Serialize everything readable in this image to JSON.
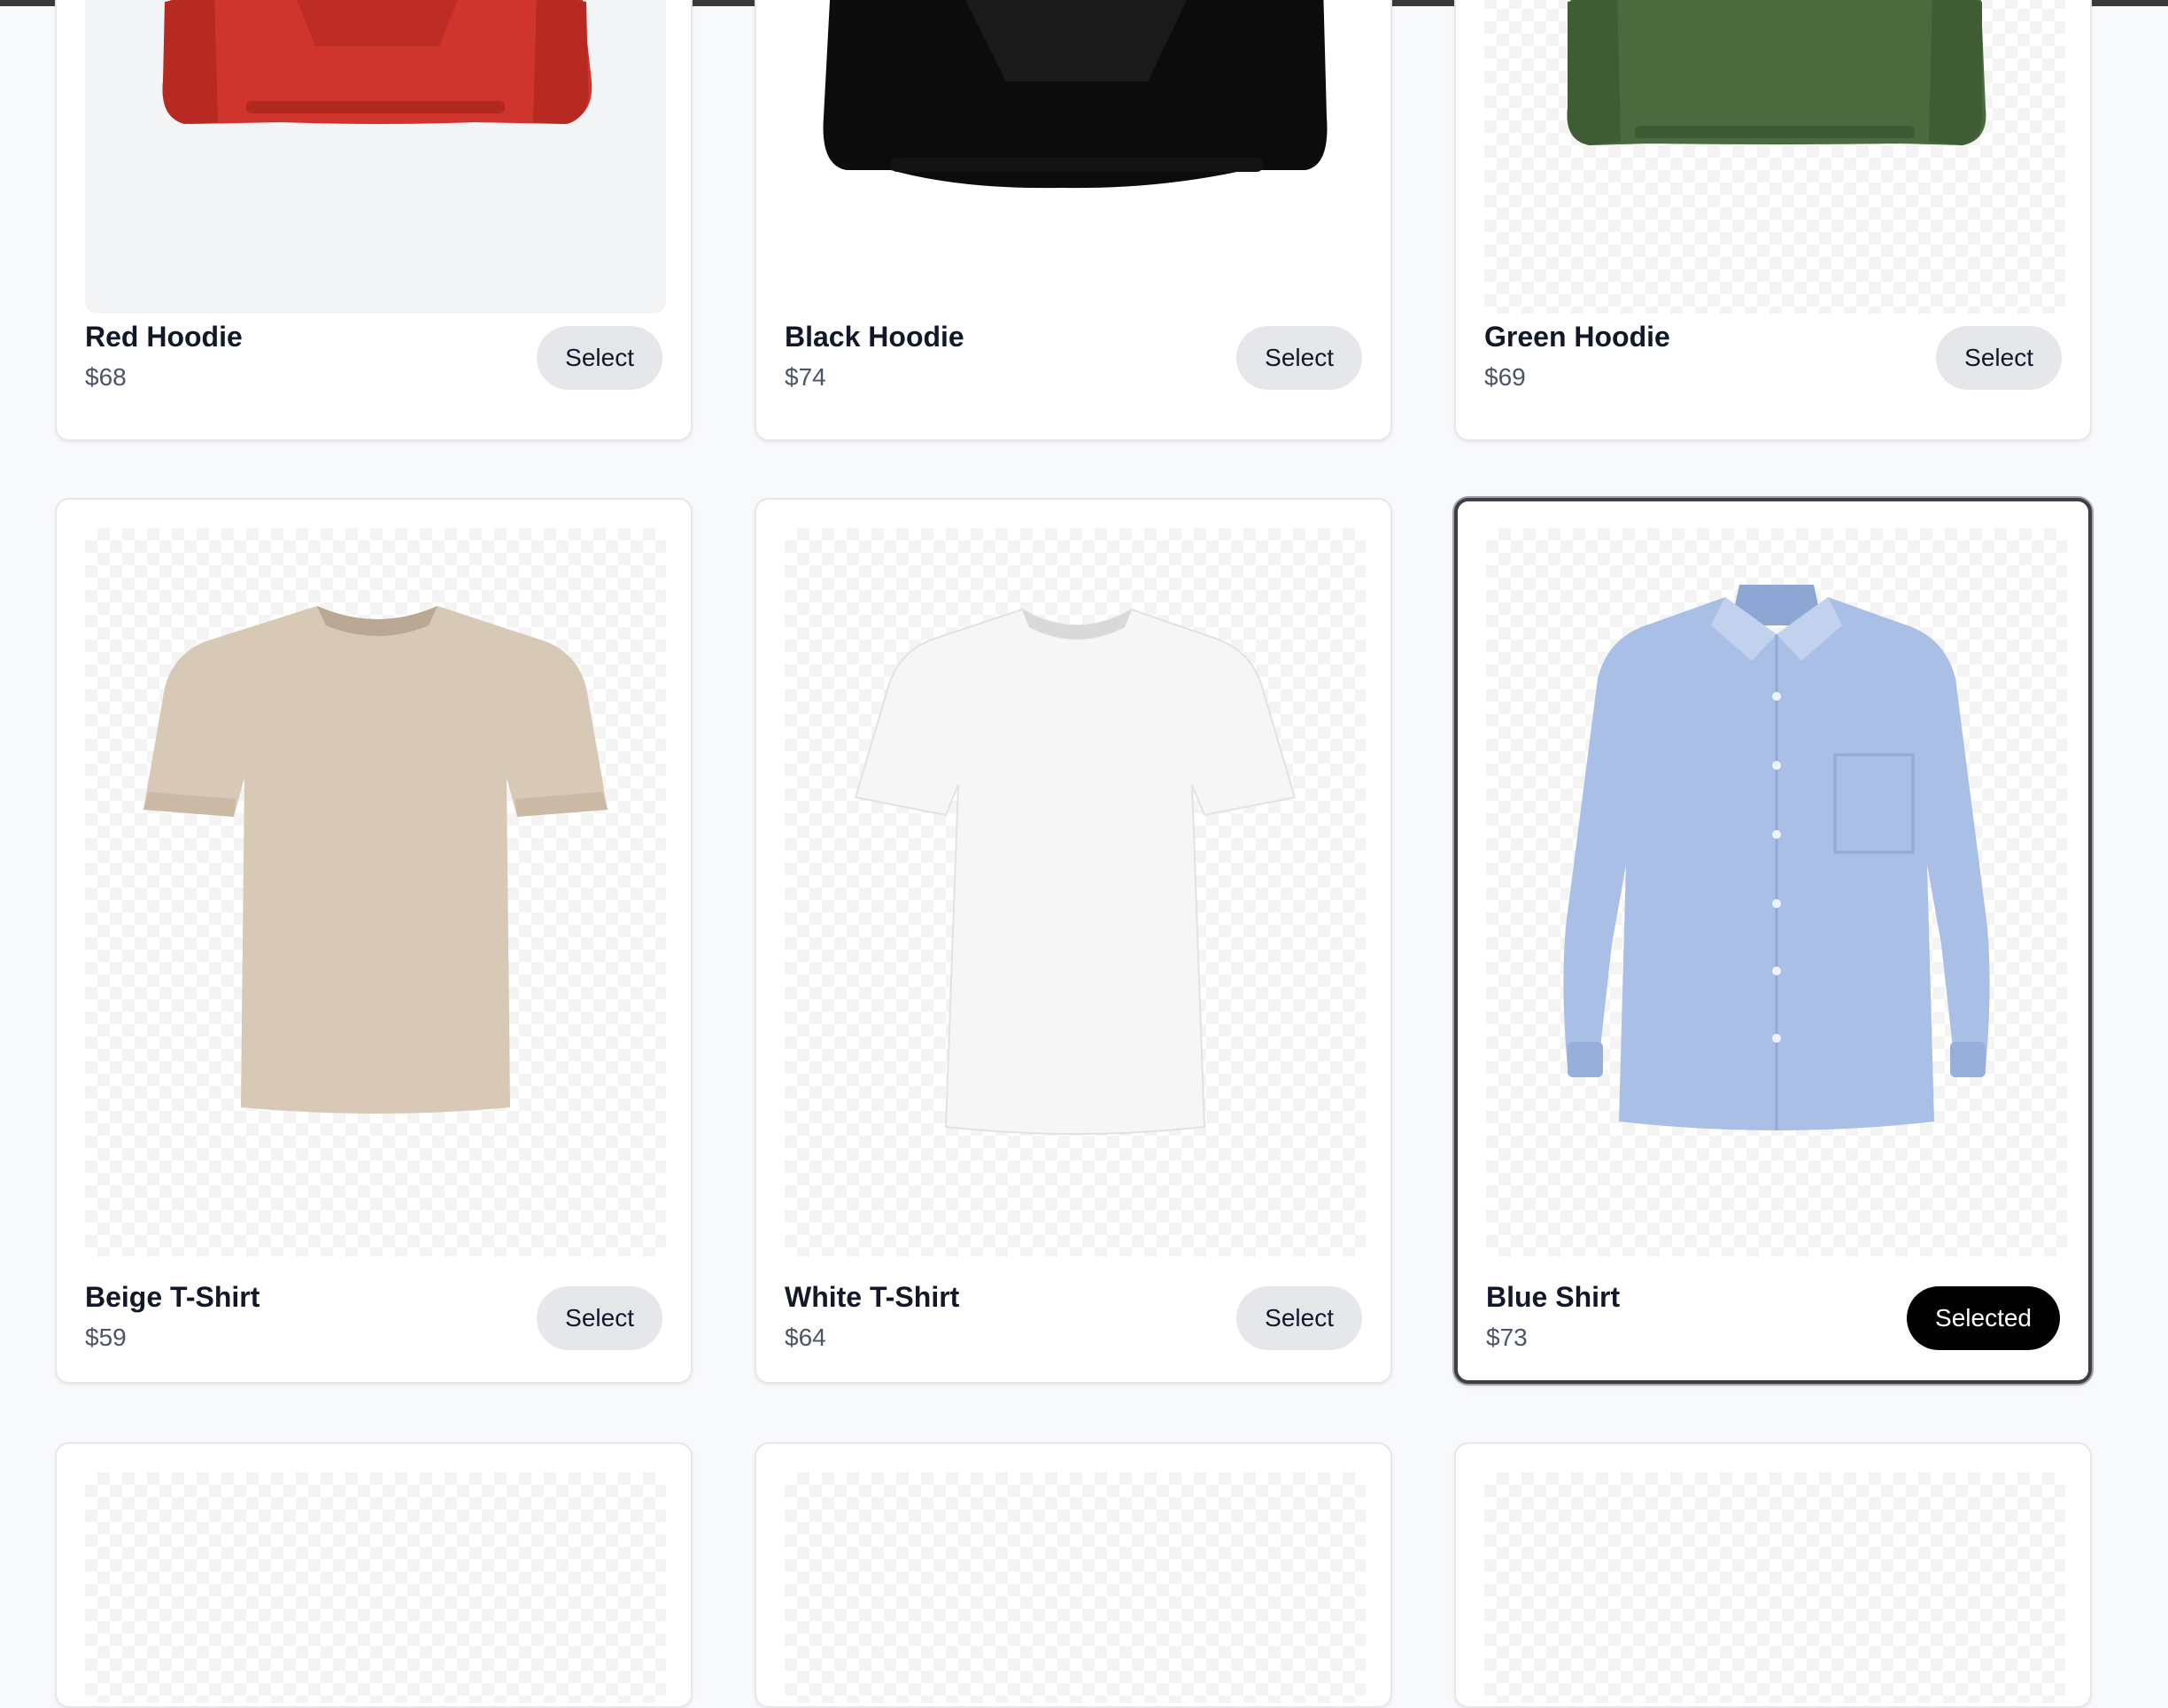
{
  "products": [
    {
      "name": "Red Hoodie",
      "price": "$68",
      "button": "Select",
      "color": "#d0342c",
      "kind": "hoodie",
      "selected": false
    },
    {
      "name": "Black Hoodie",
      "price": "$74",
      "button": "Select",
      "color": "#0b0b0b",
      "kind": "hoodie",
      "selected": false
    },
    {
      "name": "Green Hoodie",
      "price": "$69",
      "button": "Select",
      "color": "#4a6b3e",
      "kind": "hoodie",
      "selected": false
    },
    {
      "name": "Beige T-Shirt",
      "price": "$59",
      "button": "Select",
      "color": "#d8c9b6",
      "kind": "tshirt",
      "selected": false
    },
    {
      "name": "White T-Shirt",
      "price": "$64",
      "button": "Select",
      "color": "#f7f7f7",
      "kind": "tshirt",
      "selected": false
    },
    {
      "name": "Blue Shirt",
      "price": "$73",
      "button": "Selected",
      "color": "#a9bfe6",
      "kind": "shirt",
      "selected": true
    }
  ],
  "colors": {
    "selected_button": "#000000",
    "default_button": "#e5e7eb",
    "page_bg": "#f8f9fb"
  }
}
